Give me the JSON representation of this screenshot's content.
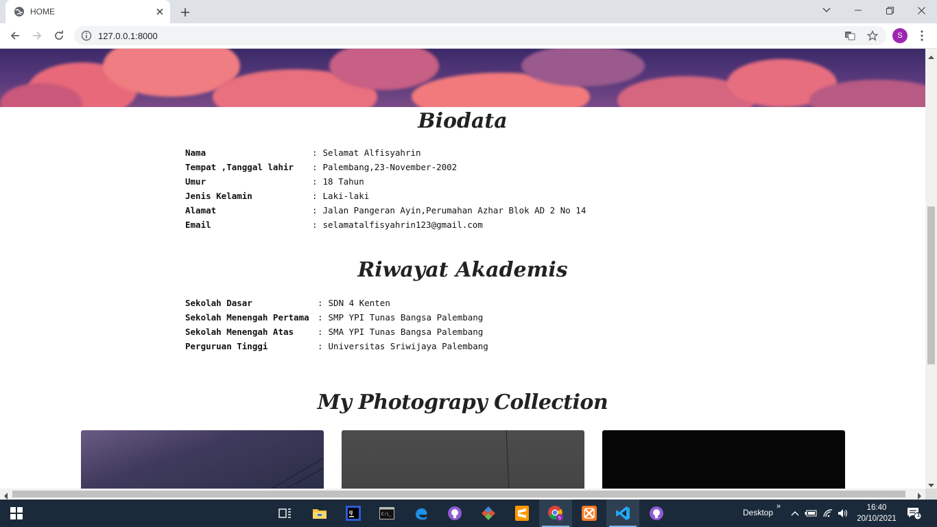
{
  "browser": {
    "tab_title": "HOME",
    "url": "127.0.0.1:8000",
    "profile_initial": "S"
  },
  "page": {
    "biodata_heading": "Biodata",
    "biodata": [
      {
        "label": "Nama",
        "sep": ":",
        "value": "Selamat Alfisyahrin"
      },
      {
        "label": "Tempat ,Tanggal lahir",
        "sep": ":",
        "value": "Palembang,23-November-2002"
      },
      {
        "label": "Umur",
        "sep": ":",
        "value": "18 Tahun"
      },
      {
        "label": "Jenis Kelamin",
        "sep": ":",
        "value": "Laki-laki"
      },
      {
        "label": "Alamat",
        "sep": ":",
        "value": "Jalan Pangeran Ayin,Perumahan Azhar Blok AD 2 No 14"
      },
      {
        "label": "Email",
        "sep": ":",
        "value": "selamatalfisyahrin123@gmail.com"
      }
    ],
    "akademis_heading": "Riwayat Akademis",
    "akademis": [
      {
        "label": "Sekolah Dasar",
        "sep": ":",
        "value": "SDN 4 Kenten"
      },
      {
        "label": "Sekolah Menengah Pertama",
        "sep": ":",
        "value": "SMP YPI Tunas Bangsa Palembang"
      },
      {
        "label": "Sekolah Menengah Atas",
        "sep": ":",
        "value": "SMA YPI Tunas Bangsa Palembang"
      },
      {
        "label": "Perguruan Tinggi",
        "sep": ":",
        "value": "Universitas Sriwijaya Palembang"
      }
    ],
    "photo_heading": "My Photograpy Collection"
  },
  "taskbar": {
    "desktop_label": "Desktop",
    "overflow_chevron": "»",
    "time": "16:40",
    "date": "20/10/2021",
    "notification_count": "1",
    "apps": [
      "task-view-icon",
      "file-explorer-icon",
      "intellij-icon",
      "terminal-icon",
      "edge-icon",
      "github-desktop-icon",
      "git-icon",
      "sublime-text-icon",
      "chrome-icon",
      "xampp-icon",
      "vscode-icon",
      "github-icon"
    ]
  },
  "colors": {
    "tabstrip": "#dee1e6",
    "taskbar": "#1b2a3a",
    "avatar": "#9c27b0",
    "heading_text": "#222222"
  }
}
